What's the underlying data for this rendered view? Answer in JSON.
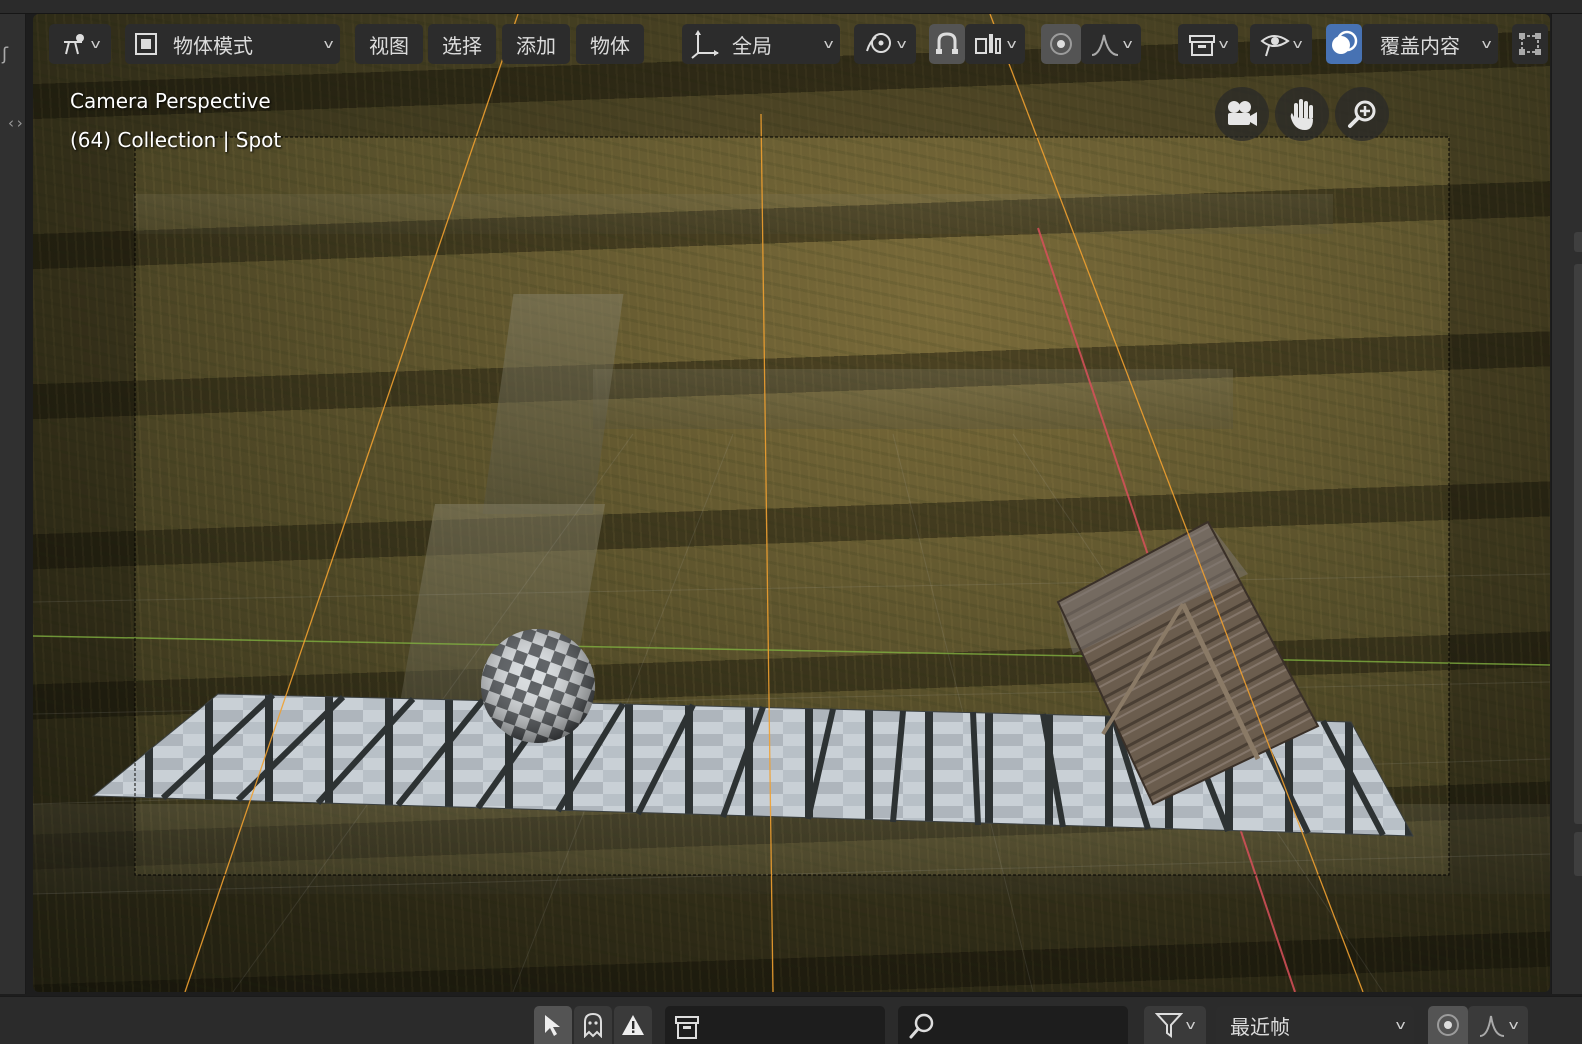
{
  "header": {
    "mode_label": "物体模式",
    "menus": [
      "视图",
      "选择",
      "添加",
      "物体"
    ],
    "transform_orientation": "全局",
    "overlays_label": "覆盖内容"
  },
  "viewport": {
    "camera_label": "Camera Perspective",
    "scene_info": "(64) Collection | Spot"
  },
  "bottom": {
    "filter_value": "最近帧",
    "search_placeholder": ""
  },
  "colors": {
    "accent_active": "#4772b3",
    "camera_guides": "#f0a030",
    "x_axis": "#d8505a",
    "y_axis": "#80b040"
  },
  "icons": [
    "interaction-mode-icon",
    "object-mode-icon",
    "transform-orientation-icon",
    "pivot-point-icon",
    "snap-icon",
    "snap-increment-icon",
    "proportional-edit-icon",
    "falloff-icon",
    "visibility-icon",
    "gizmo-icon",
    "overlay-icon",
    "xray-icon",
    "camera-view-icon",
    "hand-pan-icon",
    "zoom-icon",
    "select-icon",
    "ghost-icon",
    "warning-icon",
    "keyframe-icon",
    "search-icon",
    "filter-icon",
    "proportional-icon",
    "curve-icon"
  ]
}
